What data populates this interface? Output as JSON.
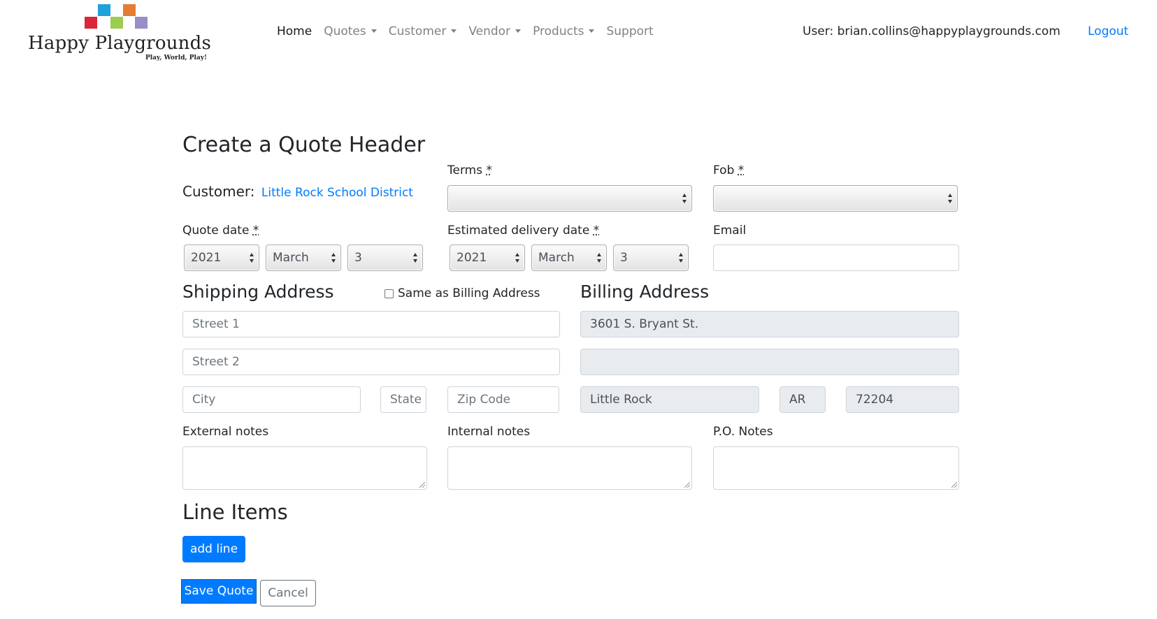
{
  "brand": {
    "name": "Happy Playgrounds",
    "tagline": "Play, World, Play!",
    "colors": [
      "#1fa2dc",
      "#d8263a",
      "#9ccd4e",
      "#e37d35",
      "#9b8ec6"
    ]
  },
  "nav": {
    "items": [
      {
        "label": "Home",
        "active": true,
        "dropdown": false
      },
      {
        "label": "Quotes",
        "active": false,
        "dropdown": true
      },
      {
        "label": "Customer",
        "active": false,
        "dropdown": true
      },
      {
        "label": "Vendor",
        "active": false,
        "dropdown": true
      },
      {
        "label": "Products",
        "active": false,
        "dropdown": true
      },
      {
        "label": "Support",
        "active": false,
        "dropdown": false
      }
    ],
    "user_text": "User: brian.collins@happyplaygrounds.com",
    "logout_label": "Logout"
  },
  "form": {
    "title": "Create a Quote Header",
    "customer_label": "Customer:",
    "customer_name": "Little Rock School District",
    "terms_label": "Terms",
    "fob_label": "Fob",
    "required_mark": "*",
    "terms_value": "",
    "fob_value": "",
    "quote_date_label": "Quote date",
    "quote_date": {
      "year": "2021",
      "month": "March",
      "day": "3"
    },
    "delivery_date_label": "Estimated delivery date",
    "delivery_date": {
      "year": "2021",
      "month": "March",
      "day": "3"
    },
    "email_label": "Email",
    "email_value": ""
  },
  "shipping": {
    "heading": "Shipping Address",
    "same_as_billing_label": "Same as Billing Address",
    "same_as_billing_checked": false,
    "street1_placeholder": "Street 1",
    "street2_placeholder": "Street 2",
    "city_placeholder": "City",
    "state_placeholder": "State",
    "zip_placeholder": "Zip Code"
  },
  "billing": {
    "heading": "Billing Address",
    "street1": "3601 S. Bryant St.",
    "street2": "",
    "city": "Little Rock",
    "state": "AR",
    "zip": "72204"
  },
  "notes": {
    "external_label": "External notes",
    "internal_label": "Internal notes",
    "po_label": "P.O. Notes"
  },
  "line_items": {
    "heading": "Line Items",
    "add_label": "add line"
  },
  "actions": {
    "save_label": "Save Quote",
    "cancel_label": "Cancel"
  },
  "colors": {
    "primary": "#007bff",
    "readonly_bg": "#e9ecef"
  }
}
